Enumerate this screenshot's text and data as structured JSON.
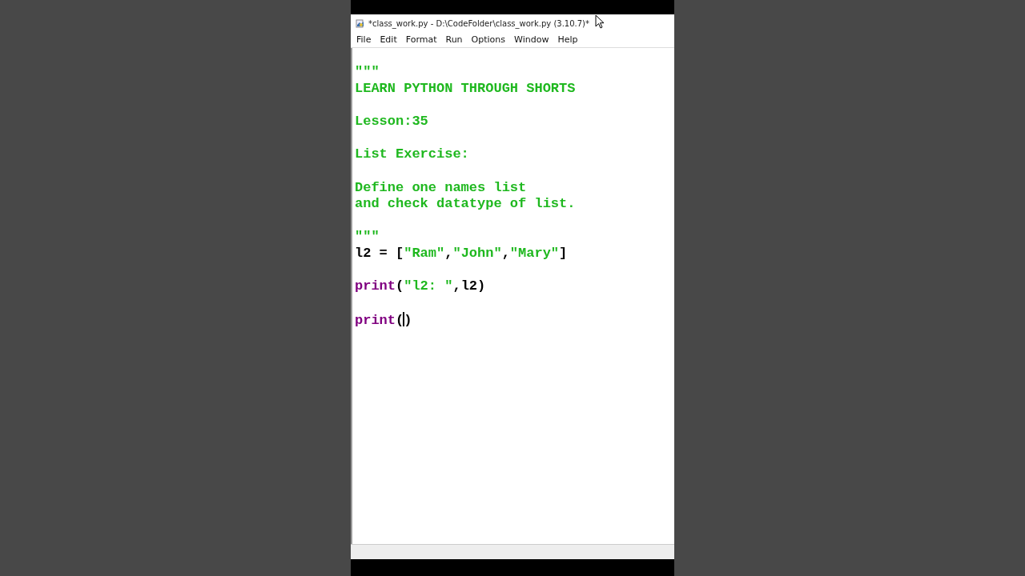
{
  "window": {
    "title": "*class_work.py - D:\\CodeFolder\\class_work.py (3.10.7)*"
  },
  "menu": [
    "File",
    "Edit",
    "Format",
    "Run",
    "Options",
    "Window",
    "Help"
  ],
  "editor": {
    "lines": [
      {
        "blank_before": false,
        "segments": [
          {
            "kind": "string",
            "text": "\"\"\""
          }
        ]
      },
      {
        "blank_before": false,
        "segments": [
          {
            "kind": "string",
            "text": "LEARN PYTHON THROUGH SHORTS"
          }
        ]
      },
      {
        "blank_before": true,
        "segments": [
          {
            "kind": "string",
            "text": "Lesson:35"
          }
        ]
      },
      {
        "blank_before": true,
        "segments": [
          {
            "kind": "string",
            "text": "List Exercise:"
          }
        ]
      },
      {
        "blank_before": true,
        "segments": [
          {
            "kind": "string",
            "text": "Define one names list"
          }
        ]
      },
      {
        "blank_before": false,
        "segments": [
          {
            "kind": "string",
            "text": "and check datatype of list."
          }
        ]
      },
      {
        "blank_before": true,
        "segments": [
          {
            "kind": "string",
            "text": "\"\"\""
          }
        ]
      },
      {
        "blank_before": false,
        "segments": [
          {
            "kind": "plain",
            "text": "l2 = ["
          },
          {
            "kind": "string",
            "text": "\"Ram\""
          },
          {
            "kind": "plain",
            "text": ","
          },
          {
            "kind": "string",
            "text": "\"John\""
          },
          {
            "kind": "plain",
            "text": ","
          },
          {
            "kind": "string",
            "text": "\"Mary\""
          },
          {
            "kind": "plain",
            "text": "]"
          }
        ]
      },
      {
        "blank_before": true,
        "segments": [
          {
            "kind": "builtin",
            "text": "print"
          },
          {
            "kind": "plain",
            "text": "("
          },
          {
            "kind": "string",
            "text": "\"l2: \""
          },
          {
            "kind": "plain",
            "text": ",l2)"
          }
        ]
      },
      {
        "blank_before": true,
        "segments": [
          {
            "kind": "builtin",
            "text": "print"
          },
          {
            "kind": "plain",
            "text": "("
          },
          {
            "kind": "caret"
          },
          {
            "kind": "plain",
            "text": ")"
          }
        ]
      }
    ]
  }
}
